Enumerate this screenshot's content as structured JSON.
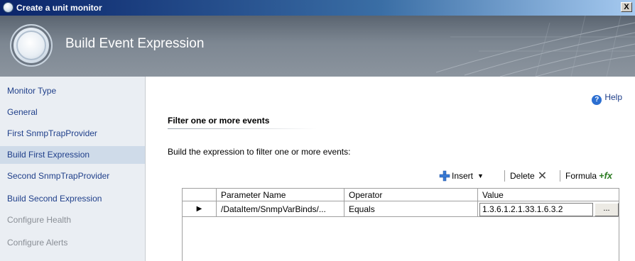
{
  "window": {
    "title": "Create a unit monitor",
    "close_label": "X"
  },
  "banner": {
    "title": "Build Event Expression"
  },
  "sidebar": {
    "items": [
      {
        "label": "Monitor Type",
        "state": "link"
      },
      {
        "label": "General",
        "state": "link"
      },
      {
        "label": "First SnmpTrapProvider",
        "state": "link"
      },
      {
        "label": "Build First Expression",
        "state": "active"
      },
      {
        "label": "Second SnmpTrapProvider",
        "state": "link"
      },
      {
        "label": "Build Second Expression",
        "state": "link"
      },
      {
        "label": "Configure Health",
        "state": "disabled"
      },
      {
        "label": "Configure Alerts",
        "state": "disabled"
      }
    ]
  },
  "main": {
    "help_label": "Help",
    "section_title": "Filter one or more events",
    "instruction": "Build the expression to filter one or more events:",
    "toolbar": {
      "insert_label": "Insert",
      "delete_label": "Delete",
      "formula_label": "Formula"
    },
    "grid": {
      "columns": [
        "Parameter Name",
        "Operator",
        "Value"
      ],
      "rows": [
        {
          "parameter": "/DataItem/SnmpVarBinds/...",
          "operator": "Equals",
          "value": "1.3.6.1.2.1.33.1.6.3.2",
          "button": "..."
        }
      ]
    }
  },
  "colors": {
    "title_bar_start": "#0a246a",
    "link_text": "#1f3f8a",
    "active_nav_bg": "#cfdbe9",
    "sidebar_bg": "#eaeef3"
  }
}
